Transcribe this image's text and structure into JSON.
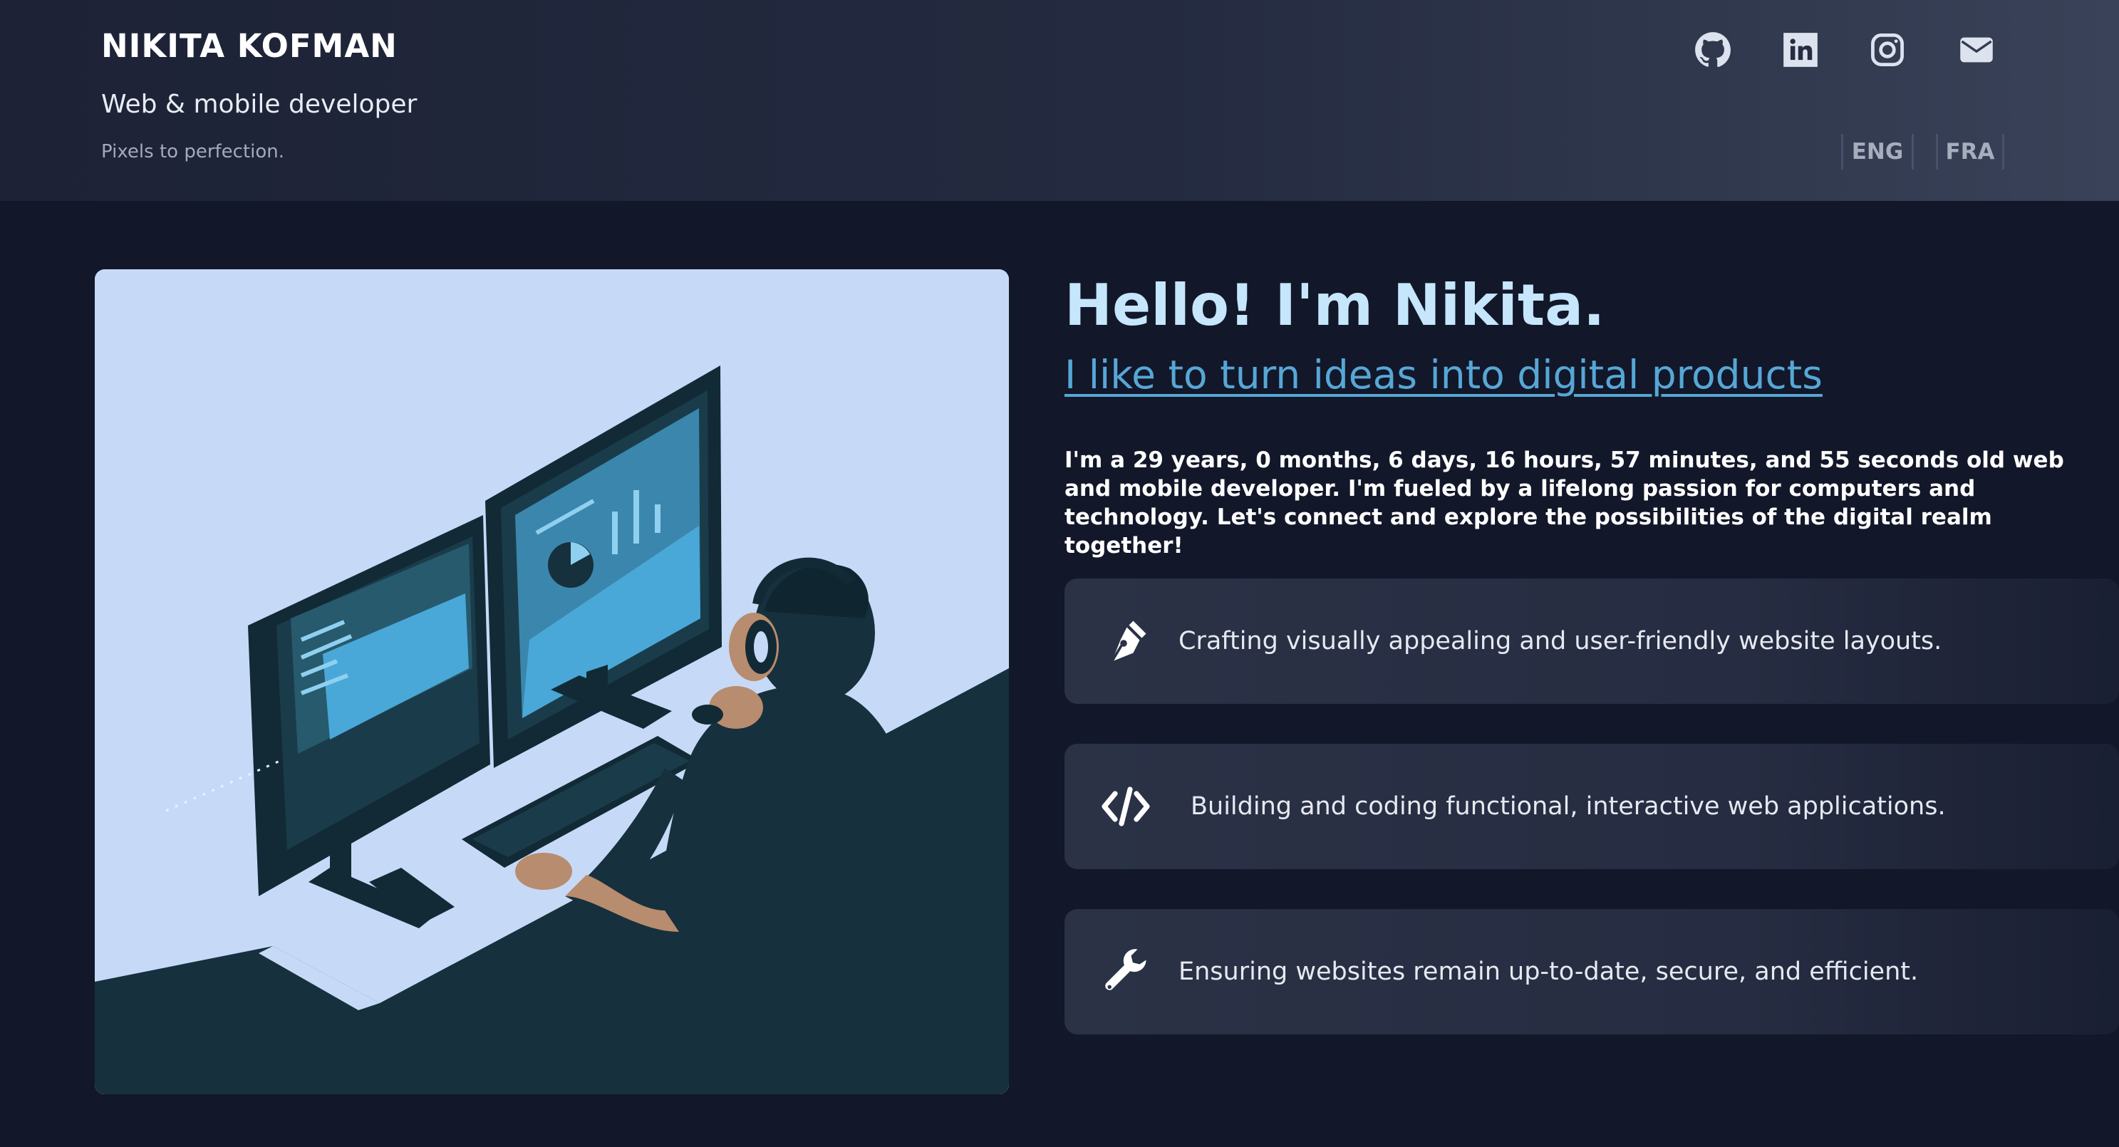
{
  "header": {
    "name": "NIKITA KOFMAN",
    "role": "Web & mobile developer",
    "tagline": "Pixels to perfection.",
    "social": [
      {
        "icon": "github-icon"
      },
      {
        "icon": "linkedin-icon"
      },
      {
        "icon": "instagram-icon"
      },
      {
        "icon": "mail-icon"
      }
    ],
    "languages": [
      "ENG",
      "FRA"
    ]
  },
  "hero": {
    "illustration_icon": "developer-at-desk-illustration",
    "greeting": "Hello! I'm Nikita.",
    "subheading": "I like to turn ideas into digital products",
    "bio": "I'm a 29 years, 0 months, 6 days, 16 hours, 57 minutes, and 55 seconds old web and mobile developer. I'm fueled by a lifelong passion for computers and technology. Let's connect and explore the possibilities of the digital realm together!"
  },
  "services": [
    {
      "icon": "pen-nib-icon",
      "text": "Crafting visually appealing and user-friendly website layouts."
    },
    {
      "icon": "code-icon",
      "text": "Building and coding functional, interactive web applications."
    },
    {
      "icon": "wrench-icon",
      "text": "Ensuring websites remain up-to-date, secure, and efficient."
    }
  ],
  "colors": {
    "background": "#121729",
    "header_gradient_start": "#1d2236",
    "header_gradient_end": "#394258",
    "greeting": "#c5e6fb",
    "accent_link": "#56a7d6",
    "illustration_bg": "#c6daf8",
    "illustration_dark": "#16303d",
    "illustration_accent": "#4aa8d8"
  }
}
